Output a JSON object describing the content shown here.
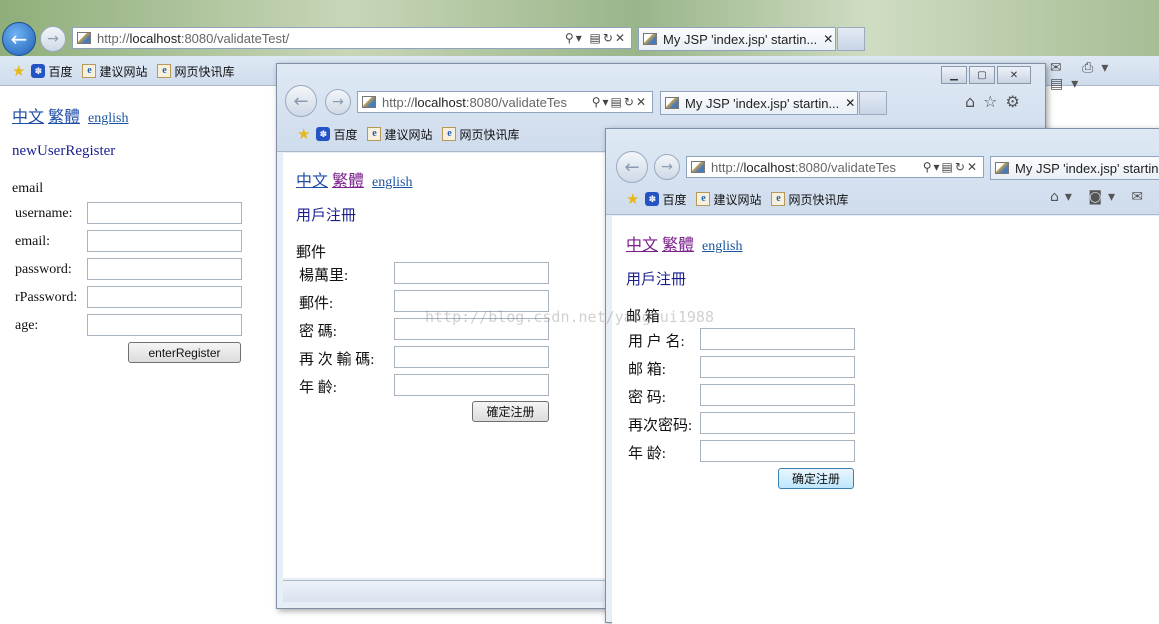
{
  "win1": {
    "url_prefix": "http://",
    "url_host": "localhost",
    "url_rest": ":8080/validateTest/",
    "tab_title": "My JSP 'index.jsp' startin...",
    "favorites": [
      "百度",
      "建议网站",
      "网页快讯库"
    ],
    "lang": {
      "zh": "中文",
      "tw": "繁體",
      "en": "english"
    },
    "form_title": "newUserRegister",
    "section": "email",
    "labels": [
      "username:",
      "email:",
      "password:",
      "rPassword:",
      "age:"
    ],
    "button": "enterRegister"
  },
  "win2": {
    "url_prefix": "http://",
    "url_host": "localhost",
    "url_rest": ":8080/validateTes",
    "tab_title": "My JSP 'index.jsp' startin...",
    "favorites": [
      "百度",
      "建议网站",
      "网页快讯库"
    ],
    "lang": {
      "zh": "中文",
      "tw": "繁體",
      "en": "english"
    },
    "form_title": "用戶注冊",
    "section": "郵件",
    "labels": [
      "楊萬里:",
      "郵件:",
      "密 碼:",
      "再 次 輸 碼:",
      "年 齡:"
    ],
    "button": "確定注册"
  },
  "win3": {
    "url_prefix": "http://",
    "url_host": "localhost",
    "url_rest": ":8080/validateTes",
    "tab_title": "My JSP 'index.jsp' startin...",
    "favorites": [
      "百度",
      "建议网站",
      "网页快讯库"
    ],
    "lang": {
      "zh": "中文",
      "tw": "繁體",
      "en": "english"
    },
    "form_title": "用戶注冊",
    "section": "邮 箱",
    "labels": [
      "用 户 名:",
      "邮 箱:",
      "密 码:",
      "再次密码:",
      "年 龄:"
    ],
    "button": "确定注册"
  },
  "watermark": "http://blog.csdn.net/yangrui1988",
  "icons": [
    "back-arrow-icon",
    "forward-arrow-icon",
    "search-icon",
    "refresh-icon",
    "stop-icon",
    "home-icon",
    "star-icon",
    "gear-icon",
    "rss-icon",
    "print-icon",
    "page-icon"
  ],
  "colors": {
    "link_zh": "#1f4ea8",
    "link_tw": "#7a1f8a",
    "title": "#1a1f8f"
  }
}
